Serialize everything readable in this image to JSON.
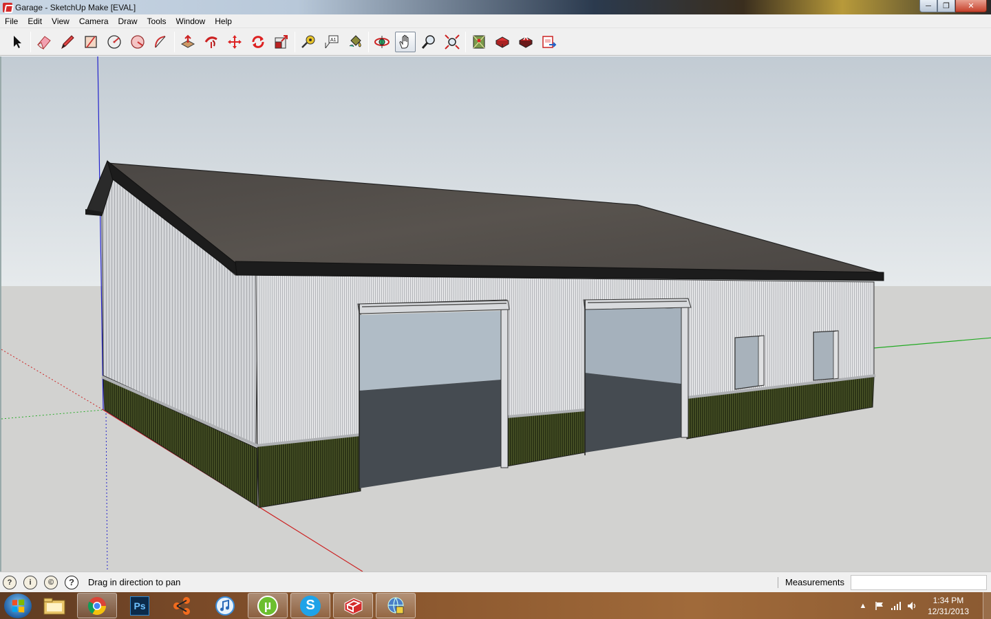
{
  "window": {
    "title": "Garage - SketchUp Make [EVAL]",
    "controls": {
      "minimize": "─",
      "maximize": "❐",
      "close": "✕"
    }
  },
  "menu": [
    "File",
    "Edit",
    "View",
    "Camera",
    "Draw",
    "Tools",
    "Window",
    "Help"
  ],
  "toolbar": {
    "groups": [
      [
        "select-tool-icon"
      ],
      [
        "eraser-tool-icon",
        "pencil-line-tool-icon",
        "rectangle-tool-icon",
        "circle-tool-icon",
        "polygon-tool-icon",
        "arc-tool-icon"
      ],
      [
        "push-pull-tool-icon",
        "follow-me-tool-icon",
        "move-tool-icon",
        "rotate-tool-icon",
        "scale-tool-icon"
      ],
      [
        "tape-measure-tool-icon",
        "text-tool-icon",
        "paint-bucket-tool-icon"
      ],
      [
        "orbit-tool-icon",
        "pan-tool-icon",
        "zoom-tool-icon",
        "zoom-extents-tool-icon"
      ],
      [
        "add-location-icon",
        "3d-warehouse-get-models-icon",
        "3d-warehouse-share-model-icon",
        "send-to-layout-icon"
      ]
    ],
    "active_tool": "pan-tool-icon"
  },
  "viewport": {
    "model_name": "Garage",
    "colors": {
      "sky_top": "#c2cbd3",
      "sky_bottom": "#e6eaec",
      "ground": "#d2d2d0",
      "roof": "#4e4a46",
      "siding": "#e2e3e5",
      "wainscot": "#2c3416",
      "door_opening_upper": "#b0bcc6",
      "door_opening_lower": "#454b51",
      "axis_red": "#cc2222",
      "axis_green": "#22aa22",
      "axis_blue": "#2222cc"
    }
  },
  "status": {
    "icons": [
      "geo-location-icon",
      "credits-icon",
      "copyright-icon",
      "help-icon"
    ],
    "icon_glyphs": [
      "?",
      "i",
      "©",
      "?"
    ],
    "message": "Drag in direction to pan",
    "measurements_label": "Measurements",
    "measurements_value": ""
  },
  "taskbar": {
    "apps": [
      "windows-explorer-icon",
      "chrome-icon",
      "photoshop-icon",
      "network-app-icon",
      "itunes-icon",
      "utorrent-icon",
      "skype-icon",
      "sketchup-icon",
      "network-settings-icon"
    ],
    "photoshop_label": "Ps",
    "skype_label": "S",
    "utorrent_label": "µ",
    "tray": {
      "show_hidden": "▲",
      "time": "1:34 PM",
      "date": "12/31/2013"
    }
  }
}
